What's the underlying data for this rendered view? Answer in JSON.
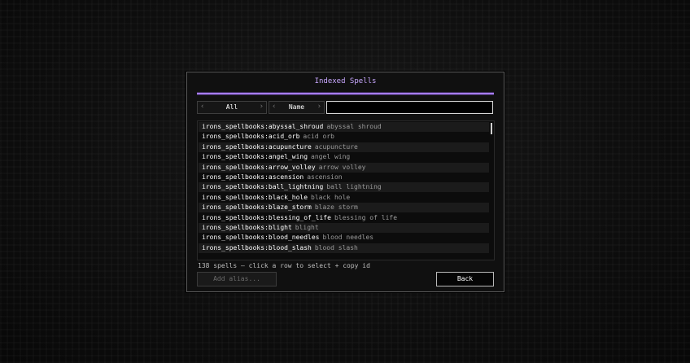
{
  "dialog": {
    "title": "Indexed Spells",
    "filter_cycler": {
      "label": "All"
    },
    "sort_cycler": {
      "label": "Name"
    },
    "search": {
      "value": ""
    },
    "rows": [
      {
        "id": "irons_spellbooks:abyssal_shroud",
        "name": "abyssal shroud"
      },
      {
        "id": "irons_spellbooks:acid_orb",
        "name": "acid orb"
      },
      {
        "id": "irons_spellbooks:acupuncture",
        "name": "acupuncture"
      },
      {
        "id": "irons_spellbooks:angel_wing",
        "name": "angel wing"
      },
      {
        "id": "irons_spellbooks:arrow_volley",
        "name": "arrow volley"
      },
      {
        "id": "irons_spellbooks:ascension",
        "name": "ascension"
      },
      {
        "id": "irons_spellbooks:ball_lightning",
        "name": "ball lightning"
      },
      {
        "id": "irons_spellbooks:black_hole",
        "name": "black hole"
      },
      {
        "id": "irons_spellbooks:blaze_storm",
        "name": "blaze storm"
      },
      {
        "id": "irons_spellbooks:blessing_of_life",
        "name": "blessing of life"
      },
      {
        "id": "irons_spellbooks:blight",
        "name": "blight"
      },
      {
        "id": "irons_spellbooks:blood_needles",
        "name": "blood needles"
      },
      {
        "id": "irons_spellbooks:blood_slash",
        "name": "blood slash"
      }
    ],
    "status": "138 spells — click a row to select + copy id",
    "add_alias_label": "Add alias...",
    "back_label": "Back"
  },
  "colors": {
    "accent": "#a67cff",
    "title": "#c9a8ff"
  }
}
